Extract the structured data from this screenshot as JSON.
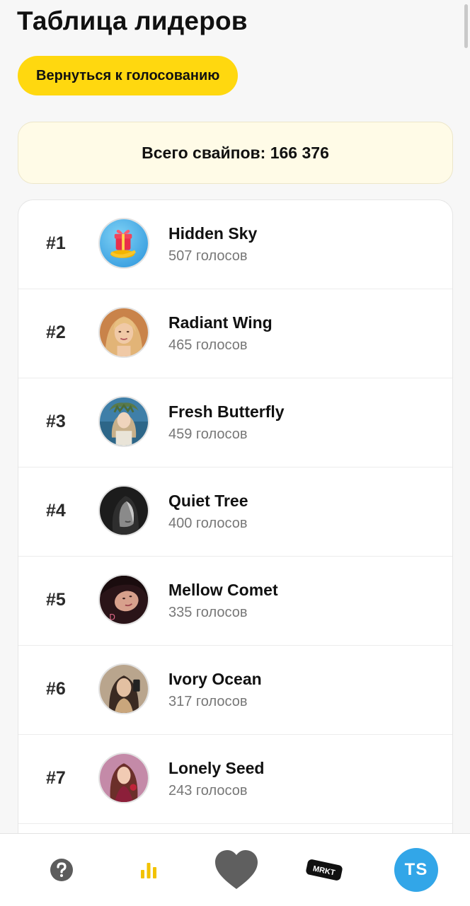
{
  "header": {
    "title": "Таблица лидеров",
    "back_button_label": "Вернуться к голосованию"
  },
  "summary": {
    "total_swipes": "Всего свайпов: 166 376"
  },
  "leaderboard": [
    {
      "rank": "#1",
      "name": "Hidden Sky",
      "votes": "507 голосов",
      "avatar": "gift-icon"
    },
    {
      "rank": "#2",
      "name": "Radiant Wing",
      "votes": "465 голосов",
      "avatar": "portrait-photo"
    },
    {
      "rank": "#3",
      "name": "Fresh Butterfly",
      "votes": "459 голосов",
      "avatar": "portrait-photo"
    },
    {
      "rank": "#4",
      "name": "Quiet Tree",
      "votes": "400 голосов",
      "avatar": "portrait-photo"
    },
    {
      "rank": "#5",
      "name": "Mellow Comet",
      "votes": "335 голосов",
      "avatar": "portrait-photo"
    },
    {
      "rank": "#6",
      "name": "Ivory Ocean",
      "votes": "317 голосов",
      "avatar": "portrait-photo"
    },
    {
      "rank": "#7",
      "name": "Lonely Seed",
      "votes": "243 голосов",
      "avatar": "portrait-photo"
    }
  ],
  "bottom_nav": {
    "help_icon": "question-circle-icon",
    "leaderboard_icon": "bar-chart-icon",
    "vote_icon": "heart-icon",
    "market_icon": "market-tag-icon",
    "market_label": "MRKT",
    "profile_initials": "TS"
  },
  "colors": {
    "accent_yellow": "#ffd80f",
    "summary_bg": "#fffbe7",
    "profile_blue": "#32a6e8",
    "heart_gray": "#5f5f5f"
  }
}
